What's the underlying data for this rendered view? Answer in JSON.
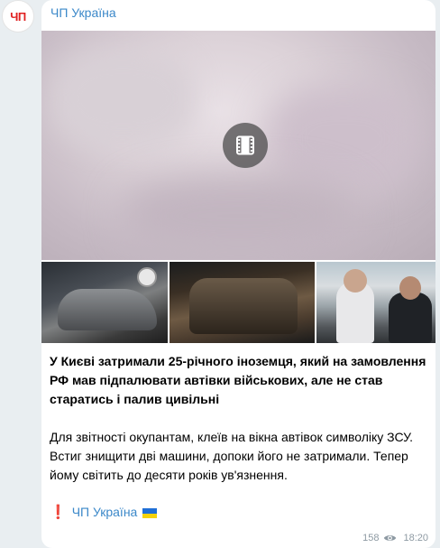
{
  "channel": {
    "avatar_text": "ЧП",
    "name": "ЧП Україна"
  },
  "media": {
    "video_icon": "film-icon",
    "thumbnails": [
      "burned-car-photo",
      "burned-car-night-photo",
      "detainee-with-police-photo"
    ]
  },
  "post": {
    "headline": "У Києві затримали 25-річного іноземця, який на замовлення РФ мав підпалювати автівки військових, але не став старатись і палив цивільні",
    "body": "Для звітності окупантам, клеїв на вікна автівок символіку ЗСУ. Встиг знищити дві машини, допоки його не затримали. Тепер йому світить до десяти років ув'язнення.",
    "signature_mark": "❗",
    "signature_link": "ЧП Україна",
    "signature_flag": "ukraine-flag-icon"
  },
  "meta": {
    "views": "158",
    "views_icon": "eye-icon",
    "time": "18:20"
  },
  "colors": {
    "link": "#3b88c9",
    "background": "#e9eef1",
    "bubble": "#ffffff",
    "meta": "#8e9aa3",
    "alert": "#e01818"
  }
}
